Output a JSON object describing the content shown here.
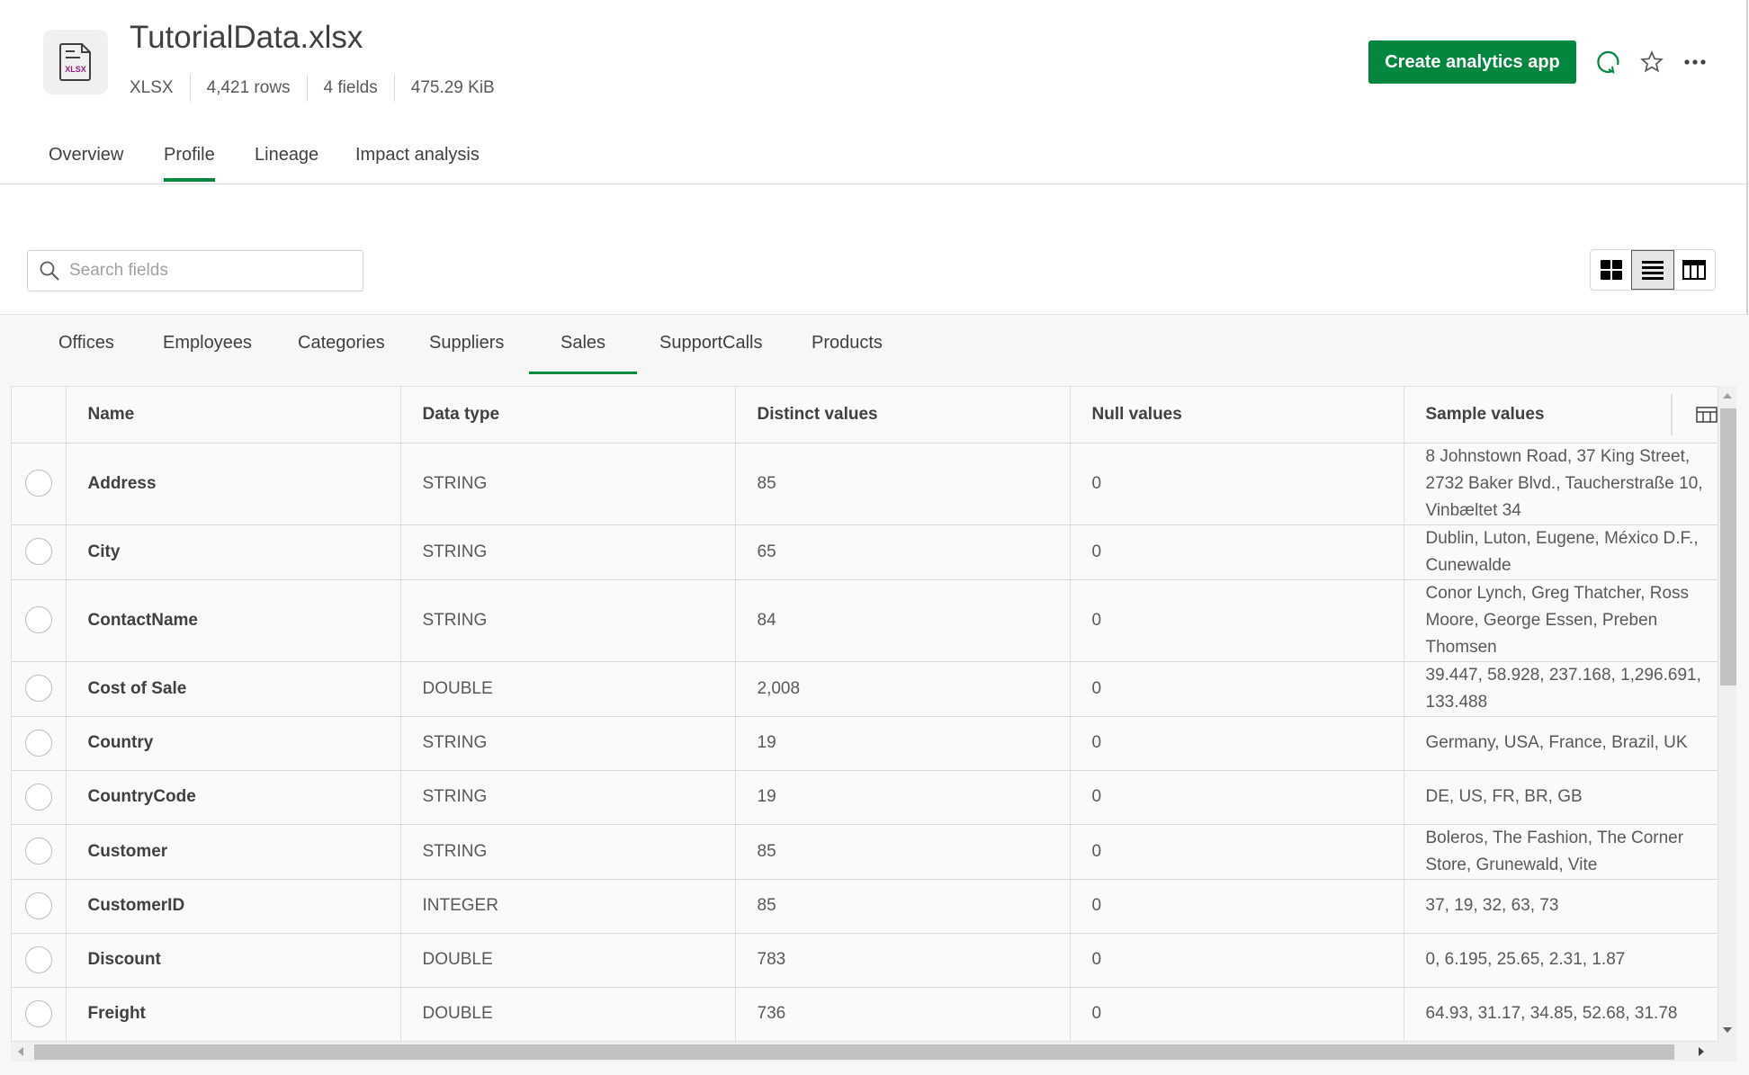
{
  "header": {
    "title": "TutorialData.xlsx",
    "file_icon_label": "XLSX",
    "meta": [
      "XLSX",
      "4,421 rows",
      "4 fields",
      "475.29 KiB"
    ],
    "create_button": "Create analytics app",
    "accent": "#03873e"
  },
  "tabs": [
    {
      "label": "Overview"
    },
    {
      "label": "Profile",
      "active": true
    },
    {
      "label": "Lineage"
    },
    {
      "label": "Impact analysis"
    }
  ],
  "search": {
    "placeholder": "Search fields",
    "value": ""
  },
  "view_modes": [
    {
      "icon": "grid-icon"
    },
    {
      "icon": "list-icon",
      "selected": true
    },
    {
      "icon": "table-icon"
    }
  ],
  "sheets": [
    {
      "label": "Offices"
    },
    {
      "label": "Employees"
    },
    {
      "label": "Categories"
    },
    {
      "label": "Suppliers"
    },
    {
      "label": "Sales",
      "active": true
    },
    {
      "label": "SupportCalls"
    },
    {
      "label": "Products"
    }
  ],
  "table": {
    "columns": [
      "Name",
      "Data type",
      "Distinct values",
      "Null values",
      "Sample values"
    ],
    "rows": [
      {
        "name": "Address",
        "type": "STRING",
        "distinct": "85",
        "nulls": "0",
        "sample": "8 Johnstown Road, 37 King Street, 2732 Baker Blvd., Taucherstraße 10, Vinbæltet 34"
      },
      {
        "name": "City",
        "type": "STRING",
        "distinct": "65",
        "nulls": "0",
        "sample": "Dublin, Luton, Eugene, México D.F., Cunewalde"
      },
      {
        "name": "ContactName",
        "type": "STRING",
        "distinct": "84",
        "nulls": "0",
        "sample": "Conor Lynch, Greg Thatcher, Ross Moore, George Essen, Preben Thomsen"
      },
      {
        "name": "Cost of Sale",
        "type": "DOUBLE",
        "distinct": "2,008",
        "nulls": "0",
        "sample": "39.447, 58.928, 237.168, 1,296.691, 133.488"
      },
      {
        "name": "Country",
        "type": "STRING",
        "distinct": "19",
        "nulls": "0",
        "sample": "Germany, USA, France, Brazil, UK"
      },
      {
        "name": "CountryCode",
        "type": "STRING",
        "distinct": "19",
        "nulls": "0",
        "sample": "DE, US, FR, BR, GB"
      },
      {
        "name": "Customer",
        "type": "STRING",
        "distinct": "85",
        "nulls": "0",
        "sample": "Boleros, The Fashion, The Corner Store, Grunewald, Vite"
      },
      {
        "name": "CustomerID",
        "type": "INTEGER",
        "distinct": "85",
        "nulls": "0",
        "sample": "37, 19, 32, 63, 73"
      },
      {
        "name": "Discount",
        "type": "DOUBLE",
        "distinct": "783",
        "nulls": "0",
        "sample": "0, 6.195, 25.65, 2.31, 1.87"
      },
      {
        "name": "Freight",
        "type": "DOUBLE",
        "distinct": "736",
        "nulls": "0",
        "sample": "64.93, 31.17, 34.85, 52.68, 31.78"
      }
    ]
  }
}
